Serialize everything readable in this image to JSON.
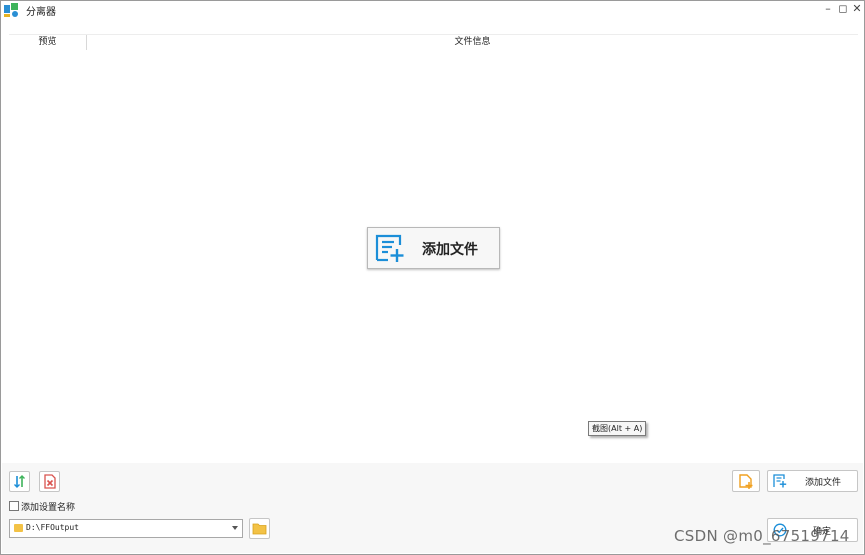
{
  "window": {
    "title": "分离器"
  },
  "table": {
    "columns": [
      "预览",
      "文件信息"
    ]
  },
  "center": {
    "add_file_label": "添加文件"
  },
  "tooltip": {
    "text": "截图(Alt + A)"
  },
  "bottom": {
    "checkbox_label": "添加设置名称",
    "output_path": "D:\\FFOutput",
    "add_file_label": "添加文件",
    "ok_label": "确定"
  },
  "watermark": "CSDN @m0_67519714",
  "colors": {
    "accent_blue": "#1b8ed8",
    "danger_red": "#d9534f",
    "folder_yellow": "#f3c246",
    "orange": "#f0a020"
  }
}
